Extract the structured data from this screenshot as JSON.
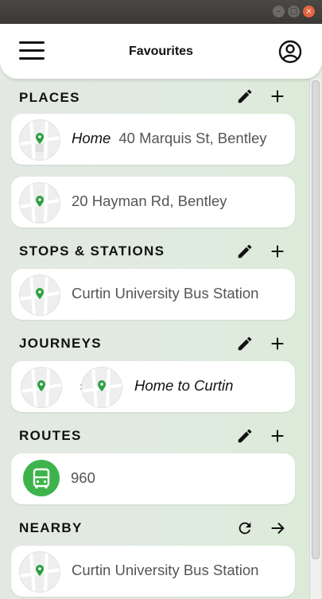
{
  "window": {
    "min": "–",
    "max": "□",
    "close": "×"
  },
  "appbar": {
    "title": "Favourites"
  },
  "colors": {
    "accent_green": "#3cb44b",
    "pin_green": "#2ea043"
  },
  "sections": {
    "places": {
      "title": "PLACES",
      "items": [
        {
          "label": "Home",
          "address": "40 Marquis St, Bentley"
        },
        {
          "label": "",
          "address": "20 Hayman Rd, Bentley"
        }
      ]
    },
    "stops": {
      "title": "STOPS & STATIONS",
      "items": [
        {
          "name": "Curtin University Bus Station"
        }
      ]
    },
    "journeys": {
      "title": "JOURNEYS",
      "items": [
        {
          "name": "Home to Curtin",
          "separator": "›"
        }
      ]
    },
    "routes": {
      "title": "ROUTES",
      "items": [
        {
          "number": "960",
          "icon": "bus-icon"
        }
      ]
    },
    "nearby": {
      "title": "NEARBY",
      "items": [
        {
          "name": "Curtin University Bus Station"
        }
      ]
    }
  }
}
